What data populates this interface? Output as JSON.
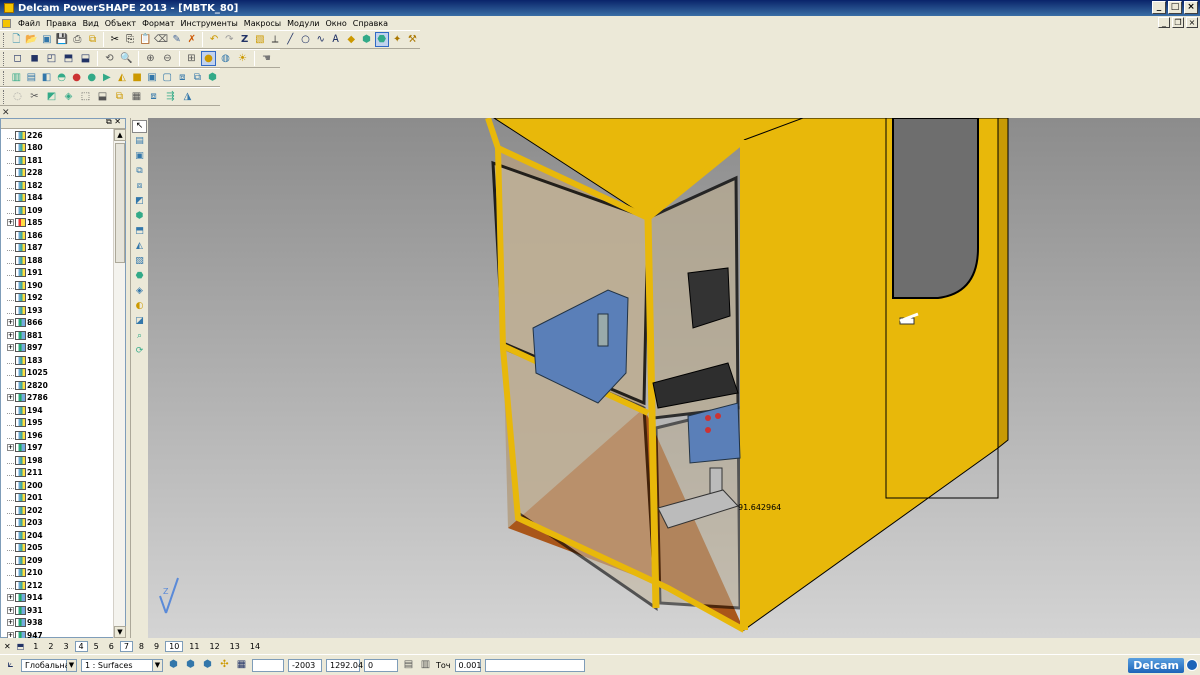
{
  "window": {
    "title": "Delcam PowerSHAPE 2013 - [MBTK_80]"
  },
  "menu": {
    "items": [
      "Файл",
      "Правка",
      "Вид",
      "Объект",
      "Формат",
      "Инструменты",
      "Макросы",
      "Модули",
      "Окно",
      "Справка"
    ]
  },
  "tree": {
    "items": [
      {
        "label": "226",
        "expander": false,
        "icon": "solid-icon"
      },
      {
        "label": "180",
        "expander": false,
        "icon": "solid-icon"
      },
      {
        "label": "181",
        "expander": false,
        "icon": "solid-icon"
      },
      {
        "label": "228",
        "expander": false,
        "icon": "solid-icon"
      },
      {
        "label": "182",
        "expander": false,
        "icon": "solid-icon"
      },
      {
        "label": "184",
        "expander": false,
        "icon": "solid-icon"
      },
      {
        "label": "109",
        "expander": false,
        "icon": "solid-icon"
      },
      {
        "label": "185",
        "expander": true,
        "icon": "red-solid-icon"
      },
      {
        "label": "186",
        "expander": false,
        "icon": "solid-icon"
      },
      {
        "label": "187",
        "expander": false,
        "icon": "solid-icon"
      },
      {
        "label": "188",
        "expander": false,
        "icon": "solid-icon"
      },
      {
        "label": "191",
        "expander": false,
        "icon": "solid-icon"
      },
      {
        "label": "190",
        "expander": false,
        "icon": "solid-icon"
      },
      {
        "label": "192",
        "expander": false,
        "icon": "solid-icon"
      },
      {
        "label": "193",
        "expander": false,
        "icon": "solid-icon"
      },
      {
        "label": "866",
        "expander": true,
        "icon": "level-icon"
      },
      {
        "label": "881",
        "expander": true,
        "icon": "level-icon"
      },
      {
        "label": "897",
        "expander": true,
        "icon": "level-icon"
      },
      {
        "label": "183",
        "expander": false,
        "icon": "solid-icon"
      },
      {
        "label": "1025",
        "expander": false,
        "icon": "solid-icon"
      },
      {
        "label": "2820",
        "expander": false,
        "icon": "solid-icon"
      },
      {
        "label": "2786",
        "expander": true,
        "icon": "level-icon"
      },
      {
        "label": "194",
        "expander": false,
        "icon": "solid-icon"
      },
      {
        "label": "195",
        "expander": false,
        "icon": "solid-icon"
      },
      {
        "label": "196",
        "expander": false,
        "icon": "solid-icon"
      },
      {
        "label": "197",
        "expander": true,
        "icon": "level-icon"
      },
      {
        "label": "198",
        "expander": false,
        "icon": "solid-icon"
      },
      {
        "label": "211",
        "expander": false,
        "icon": "solid-icon"
      },
      {
        "label": "200",
        "expander": false,
        "icon": "solid-icon"
      },
      {
        "label": "201",
        "expander": false,
        "icon": "solid-icon"
      },
      {
        "label": "202",
        "expander": false,
        "icon": "solid-icon"
      },
      {
        "label": "203",
        "expander": false,
        "icon": "solid-icon"
      },
      {
        "label": "204",
        "expander": false,
        "icon": "solid-icon"
      },
      {
        "label": "205",
        "expander": false,
        "icon": "solid-icon"
      },
      {
        "label": "209",
        "expander": false,
        "icon": "solid-icon"
      },
      {
        "label": "210",
        "expander": false,
        "icon": "solid-icon"
      },
      {
        "label": "212",
        "expander": false,
        "icon": "solid-icon"
      },
      {
        "label": "914",
        "expander": true,
        "icon": "level-icon"
      },
      {
        "label": "931",
        "expander": true,
        "icon": "level-icon"
      },
      {
        "label": "938",
        "expander": true,
        "icon": "level-icon"
      },
      {
        "label": "947",
        "expander": true,
        "icon": "level-icon"
      }
    ]
  },
  "viewport": {
    "measurement": "91.642964",
    "axis_label": "Z"
  },
  "view_tabs": {
    "items": [
      "1",
      "2",
      "3",
      "4",
      "5",
      "6",
      "7",
      "8",
      "9",
      "10",
      "11",
      "12",
      "13",
      "14"
    ],
    "active": [
      "4",
      "7",
      "10"
    ]
  },
  "status": {
    "workplane": "Глобальна",
    "level": "1  : Surfaces",
    "x_value": "-2003",
    "y_value": "1292.04",
    "z_value": "0",
    "tolerance_label": "Точ",
    "tolerance_value": "0.001",
    "brand": "Delcam"
  },
  "colors": {
    "cabin_yellow": "#e8b80a",
    "viewport_top": "#8c8c8c",
    "viewport_bottom": "#d4d4d4",
    "floor": "#a9561a",
    "console_blue": "#5a7fb8"
  }
}
